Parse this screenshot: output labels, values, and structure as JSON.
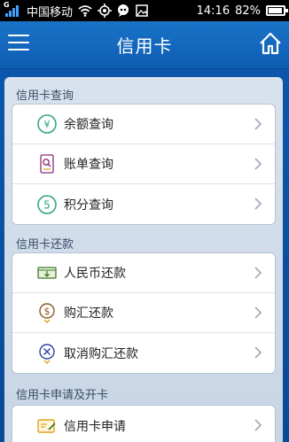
{
  "status_bar": {
    "network_type": "G",
    "carrier": "中国移动",
    "time": "14:16",
    "battery": "82%",
    "battery_level": 0.82,
    "icons": [
      "wifi-icon",
      "gps-icon",
      "chat-icon",
      "image-icon"
    ]
  },
  "app_bar": {
    "title": "信用卡",
    "left_icon": "menu-icon",
    "right_icon": "home-icon"
  },
  "sections": [
    {
      "title": "信用卡查询",
      "items": [
        {
          "label": "余额查询",
          "icon": "yen-circle-icon",
          "icon_color": "#2aa27a"
        },
        {
          "label": "账单查询",
          "icon": "bill-search-icon",
          "icon_color": "#8a2b7a"
        },
        {
          "label": "积分查询",
          "icon": "points-five-icon",
          "icon_color": "#2aa27a"
        }
      ]
    },
    {
      "title": "信用卡还款",
      "items": [
        {
          "label": "人民币还款",
          "icon": "cash-icon",
          "icon_color": "#3f7a2a"
        },
        {
          "label": "购汇还款",
          "icon": "dollar-exchange-icon",
          "icon_color": "#8a5a1c"
        },
        {
          "label": "取消购汇还款",
          "icon": "cancel-exchange-icon",
          "icon_color": "#2a3fa0"
        }
      ]
    },
    {
      "title": "信用卡申请及开卡",
      "items": [
        {
          "label": "信用卡申请",
          "icon": "card-apply-icon",
          "icon_color": "#e0a21a"
        }
      ]
    }
  ],
  "colors": {
    "app_bar": "#1a73c8",
    "background": "#0b4fa0",
    "panel": "#d9e3ee",
    "chevron": "#a5aeb9"
  }
}
